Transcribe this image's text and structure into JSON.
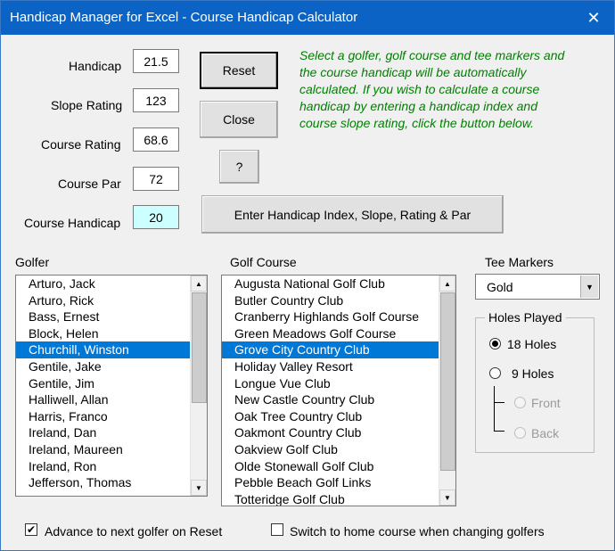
{
  "window": {
    "title": "Handicap Manager for Excel - Course Handicap Calculator",
    "close_glyph": "✕"
  },
  "fields": {
    "handicap": {
      "label": "Handicap",
      "value": "21.5"
    },
    "slope": {
      "label": "Slope Rating",
      "value": "123"
    },
    "rating": {
      "label": "Course Rating",
      "value": "68.6"
    },
    "par": {
      "label": "Course Par",
      "value": "72"
    },
    "course_handicap": {
      "label": "Course Handicap",
      "value": "20"
    }
  },
  "buttons": {
    "reset": "Reset",
    "close": "Close",
    "help": "?",
    "enter": "Enter Handicap Index, Slope, Rating & Par"
  },
  "instructions": "Select a golfer, golf course and tee markers and the course handicap will be automatically calculated. If you wish to calculate a course handicap by entering a handicap index and course slope rating, click the button below.",
  "golfer": {
    "label": "Golfer",
    "items": [
      "Arturo, Jack",
      "Arturo, Rick",
      "Bass, Ernest",
      "Block, Helen",
      "Churchill, Winston",
      "Gentile, Jake",
      "Gentile, Jim",
      "Halliwell, Allan",
      "Harris, Franco",
      "Ireland, Dan",
      "Ireland, Maureen",
      "Ireland, Ron",
      "Jefferson, Thomas"
    ],
    "selected_index": 4
  },
  "course": {
    "label": "Golf Course",
    "items": [
      "Augusta National Golf Club",
      "Butler Country Club",
      "Cranberry Highlands Golf Course",
      "Green Meadows Golf Course",
      "Grove City Country Club",
      "Holiday Valley Resort",
      "Longue Vue Club",
      "New Castle Country Club",
      "Oak Tree Country Club",
      "Oakmont Country Club",
      "Oakview Golf Club",
      "Olde Stonewall Golf Club",
      "Pebble Beach Golf Links",
      "Totteridge Golf Club"
    ],
    "selected_index": 4
  },
  "tees": {
    "label": "Tee Markers",
    "value": "Gold"
  },
  "holes": {
    "caption": "Holes Played",
    "h18": "18 Holes",
    "h9": "9 Holes",
    "front": "Front",
    "back": "Back"
  },
  "options": {
    "advance": {
      "label": "Advance to next golfer on Reset",
      "checked": true
    },
    "switch": {
      "label": "Switch to home course when changing golfers",
      "checked": false
    }
  },
  "glyphs": {
    "up": "▲",
    "down": "▼",
    "check": "✔"
  }
}
